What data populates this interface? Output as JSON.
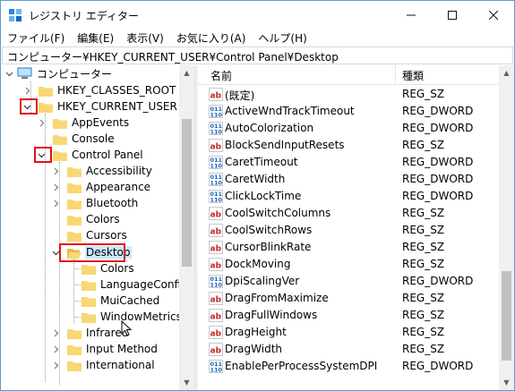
{
  "window": {
    "title": "レジストリ エディター"
  },
  "menu": [
    "ファイル(F)",
    "編集(E)",
    "表示(V)",
    "お気に入り(A)",
    "ヘルプ(H)"
  ],
  "address": "コンピューター¥HKEY_CURRENT_USER¥Control Panel¥Desktop",
  "tree": [
    {
      "label": "コンピューター",
      "icon": "computer-icon"
    },
    {
      "label": "HKEY_CLASSES_ROOT",
      "icon": "folder-icon"
    },
    {
      "label": "HKEY_CURRENT_USER",
      "icon": "folder-icon"
    },
    {
      "label": "AppEvents",
      "icon": "folder-icon"
    },
    {
      "label": "Console",
      "icon": "folder-icon"
    },
    {
      "label": "Control Panel",
      "icon": "folder-icon"
    },
    {
      "label": "Accessibility",
      "icon": "folder-icon"
    },
    {
      "label": "Appearance",
      "icon": "folder-icon"
    },
    {
      "label": "Bluetooth",
      "icon": "folder-icon"
    },
    {
      "label": "Colors",
      "icon": "folder-icon"
    },
    {
      "label": "Cursors",
      "icon": "folder-icon"
    },
    {
      "label": "Desktop",
      "icon": "folder-open-icon",
      "selected": true
    },
    {
      "label": "Colors",
      "icon": "folder-icon"
    },
    {
      "label": "LanguageConfigu",
      "icon": "folder-icon"
    },
    {
      "label": "MuiCached",
      "icon": "folder-icon"
    },
    {
      "label": "WindowMetrics",
      "icon": "folder-icon"
    },
    {
      "label": "Infrared",
      "icon": "folder-icon"
    },
    {
      "label": "Input Method",
      "icon": "folder-icon"
    },
    {
      "label": "International",
      "icon": "folder-icon"
    }
  ],
  "list": {
    "columns": [
      "名前",
      "種類"
    ],
    "rows": [
      {
        "name": "(既定)",
        "type": "REG_SZ",
        "icon": "string-value-icon"
      },
      {
        "name": "ActiveWndTrackTimeout",
        "type": "REG_DWORD",
        "icon": "binary-value-icon"
      },
      {
        "name": "AutoColorization",
        "type": "REG_DWORD",
        "icon": "binary-value-icon"
      },
      {
        "name": "BlockSendInputResets",
        "type": "REG_SZ",
        "icon": "string-value-icon"
      },
      {
        "name": "CaretTimeout",
        "type": "REG_DWORD",
        "icon": "binary-value-icon"
      },
      {
        "name": "CaretWidth",
        "type": "REG_DWORD",
        "icon": "binary-value-icon"
      },
      {
        "name": "ClickLockTime",
        "type": "REG_DWORD",
        "icon": "binary-value-icon"
      },
      {
        "name": "CoolSwitchColumns",
        "type": "REG_SZ",
        "icon": "string-value-icon"
      },
      {
        "name": "CoolSwitchRows",
        "type": "REG_SZ",
        "icon": "string-value-icon"
      },
      {
        "name": "CursorBlinkRate",
        "type": "REG_SZ",
        "icon": "string-value-icon"
      },
      {
        "name": "DockMoving",
        "type": "REG_SZ",
        "icon": "string-value-icon"
      },
      {
        "name": "DpiScalingVer",
        "type": "REG_DWORD",
        "icon": "binary-value-icon"
      },
      {
        "name": "DragFromMaximize",
        "type": "REG_SZ",
        "icon": "string-value-icon"
      },
      {
        "name": "DragFullWindows",
        "type": "REG_SZ",
        "icon": "string-value-icon"
      },
      {
        "name": "DragHeight",
        "type": "REG_SZ",
        "icon": "string-value-icon"
      },
      {
        "name": "DragWidth",
        "type": "REG_SZ",
        "icon": "string-value-icon"
      },
      {
        "name": "EnablePerProcessSystemDPI",
        "type": "REG_DWORD",
        "icon": "binary-value-icon"
      }
    ]
  },
  "colors": {
    "highlight_red": "#e0121b",
    "selection_blue": "#cce8ff",
    "folder_yellow": "#f8d775",
    "window_border": "#5b9bd5"
  }
}
